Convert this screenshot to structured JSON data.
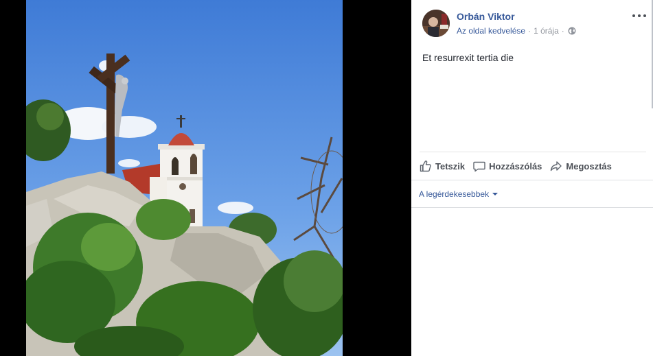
{
  "post": {
    "author": "Orbán Viktor",
    "like_page_label": "Az oldal kedvelése",
    "separator": "·",
    "time": "1 órája",
    "privacy_icon": "globe-icon",
    "text": "Et resurrexit tertia die"
  },
  "actions": {
    "like_label": "Tetszik",
    "comment_label": "Hozzászólás",
    "share_label": "Megosztás"
  },
  "comments": {
    "sort_label": "A legérdekesebbek"
  },
  "colors": {
    "link": "#365899",
    "muted": "#90949c",
    "text": "#1d2129",
    "sky": "#4f8be0"
  }
}
